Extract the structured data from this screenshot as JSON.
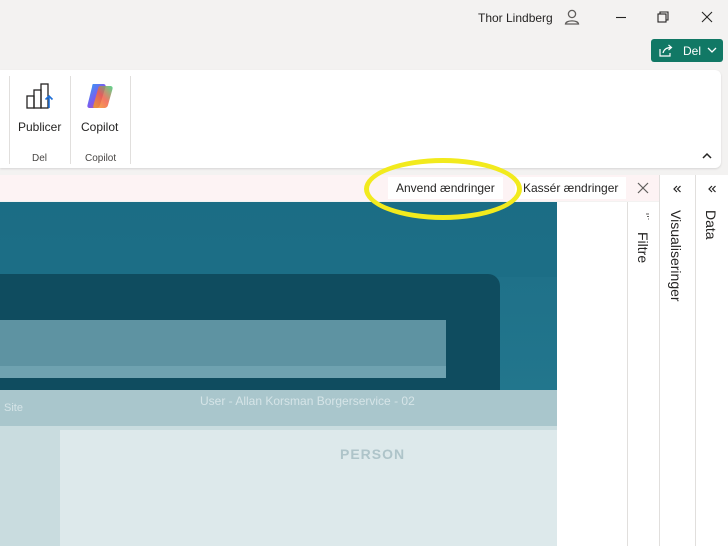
{
  "titlebar": {
    "user_name": "Thor Lindberg",
    "user_icon": "person-icon",
    "minimize_icon": "minimize-icon",
    "restore_icon": "restore-icon",
    "close_icon": "close-icon"
  },
  "share": {
    "label": "Del",
    "icon": "share-icon",
    "color": "#117865"
  },
  "ribbon": {
    "buttons": [
      {
        "label": "Publicer",
        "icon": "publish-icon"
      },
      {
        "label": "Copilot",
        "icon": "copilot-icon"
      }
    ],
    "groups": [
      {
        "label": "Del"
      },
      {
        "label": "Copilot"
      }
    ],
    "collapse_icon": "chevron-up-icon"
  },
  "notification": {
    "apply_label": "Anvend ændringer",
    "discard_label": "Kassér ændringer",
    "close_icon": "close-icon",
    "background": "#fdf3f4"
  },
  "canvas": {
    "image_title": "User - Allan Korsman Borgerservice - 02",
    "image_site": "Site",
    "image_person_label": "PERSON"
  },
  "panes": {
    "filters": "Filtre",
    "visualizations": "Visualiseringer",
    "data": "Data"
  },
  "highlight_color": "#f2ea1d"
}
